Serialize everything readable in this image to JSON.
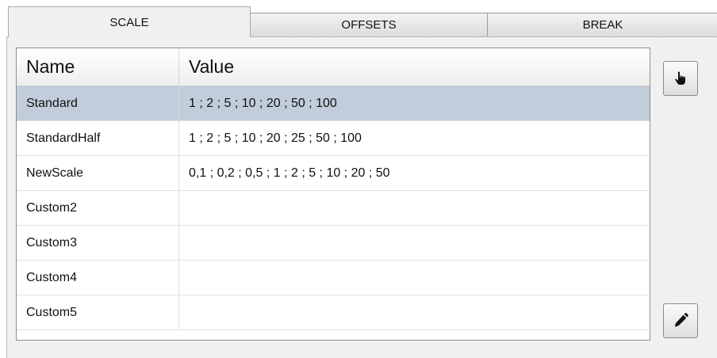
{
  "tabs": [
    {
      "label": "SCALE",
      "active": true
    },
    {
      "label": "OFFSETS",
      "active": false
    },
    {
      "label": "BREAK",
      "active": false
    }
  ],
  "table": {
    "columns": [
      "Name",
      "Value"
    ],
    "rows": [
      {
        "name": "Standard",
        "value": "1 ; 2 ; 5 ; 10 ; 20 ; 50 ; 100",
        "selected": true
      },
      {
        "name": "StandardHalf",
        "value": "1 ; 2 ; 5 ; 10 ; 20 ; 25 ; 50 ; 100",
        "selected": false
      },
      {
        "name": "NewScale",
        "value": "0,1 ; 0,2 ; 0,5 ; 1 ; 2 ; 5 ; 10 ; 20 ; 50",
        "selected": false
      },
      {
        "name": "Custom2",
        "value": "",
        "selected": false
      },
      {
        "name": "Custom3",
        "value": "",
        "selected": false
      },
      {
        "name": "Custom4",
        "value": "",
        "selected": false
      },
      {
        "name": "Custom5",
        "value": "",
        "selected": false
      }
    ]
  },
  "buttons": {
    "pick_icon": "hand-pointer-icon",
    "edit_icon": "pencil-icon"
  },
  "colors": {
    "selected_row": "#c1cddb",
    "border": "#8f8f8f"
  }
}
